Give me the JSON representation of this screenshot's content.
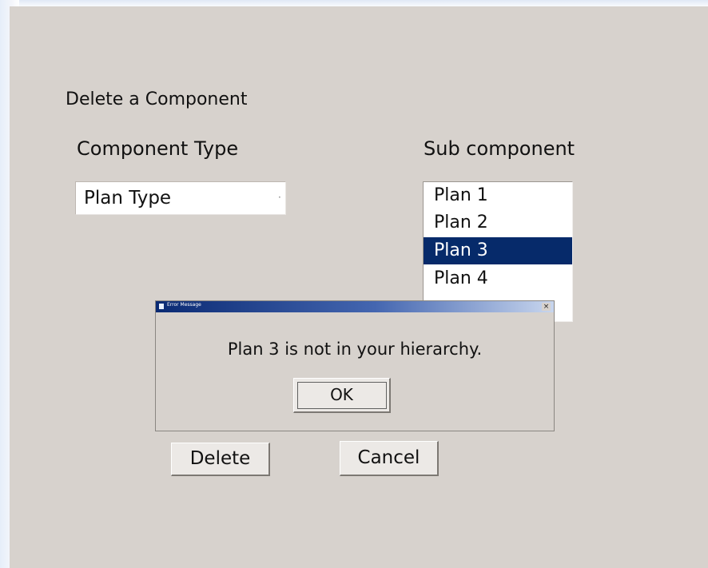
{
  "form": {
    "title": "Delete a Component",
    "component_type_label": "Component Type",
    "component_type_value": "Plan Type",
    "sub_component_label": "Sub component",
    "sub_components": [
      "Plan 1",
      "Plan 2",
      "Plan 3",
      "Plan 4"
    ],
    "selected_sub_component": "Plan 3",
    "delete_label": "Delete",
    "cancel_label": "Cancel"
  },
  "dialog": {
    "title": "Error Message",
    "message": "Plan 3 is not in your hierarchy.",
    "ok_label": "OK",
    "close_glyph": "×"
  },
  "icons": {
    "dropdown_arrow": "chevron-down-icon",
    "dialog_icon": "app-icon",
    "close": "close-icon"
  },
  "colors": {
    "selection": "#062a6a",
    "panel": "#d7d2cd",
    "title_bar_start": "#0a2a73",
    "title_bar_end": "#c8d6ee"
  }
}
